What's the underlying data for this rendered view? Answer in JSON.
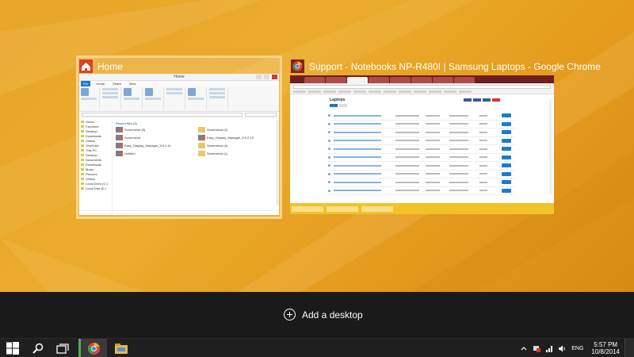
{
  "task_view": {
    "windows": [
      {
        "title": "Home",
        "icon": "folder-home-icon",
        "preview": {
          "window_title": "Home",
          "tabs": [
            "File",
            "Home",
            "Share",
            "View"
          ],
          "nav_items": [
            "Home",
            "Favorites",
            "Desktop",
            "Downloads",
            "Videos",
            "OneDrive",
            "This PC",
            "Desktop",
            "Documents",
            "Downloads",
            "Music",
            "Pictures",
            "Videos",
            "Local Drive (C:)",
            "Local Disk (E:)"
          ],
          "section": "Recent files (8)",
          "files": [
            "Screenshot (3)",
            "Screenshot (2)",
            "Screenshot",
            "Easy_Display_Manager_5.0.2.10",
            "Easy_Display_Manager_5.0.2.11",
            "Screenshot (4)",
            "Untitled",
            "Screenshot (1)"
          ]
        }
      },
      {
        "title": "Support - Notebooks NP-R480I | Samsung Laptops - Google Chrome",
        "icon": "chrome-icon",
        "preview": {
          "heading": "Laptops"
        }
      }
    ]
  },
  "add_desktop": {
    "label": "Add a desktop"
  },
  "taskbar": {
    "start": "windows-logo-icon",
    "search": "search-icon",
    "task_view": "task-view-icon",
    "apps": [
      "chrome-icon",
      "file-explorer-icon"
    ],
    "tray": {
      "language": "ENG",
      "time": "5:57 PM",
      "date": "10/8/2014"
    }
  },
  "colors": {
    "wallpaper": "#e9a521",
    "band": "#1a1a1a",
    "taskbar": "#1f1f1f",
    "selection_border": "#f4d58c",
    "explorer_accent": "#1979ca",
    "chrome_red": "#c0392b"
  }
}
